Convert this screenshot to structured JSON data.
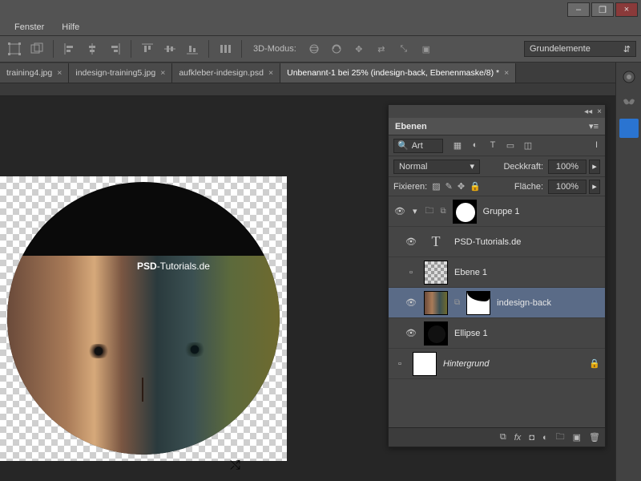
{
  "window": {
    "minimize": "–",
    "maximize": "❐",
    "close": "×"
  },
  "menu": {
    "fenster": "Fenster",
    "hilfe": "Hilfe"
  },
  "toolbar": {
    "mode_label": "3D-Modus:",
    "workspace": "Grundelemente"
  },
  "tabs": [
    {
      "label": "training4.jpg"
    },
    {
      "label": "indesign-training5.jpg"
    },
    {
      "label": "aufkleber-indesign.psd"
    },
    {
      "label": "Unbenannt-1 bei 25% (indesign-back, Ebenenmaske/8) *"
    }
  ],
  "tabs_more": "»",
  "canvas": {
    "brand_bold": "PSD",
    "brand_rest": "-Tutorials.de"
  },
  "panel": {
    "title": "Ebenen",
    "kind": "Art",
    "blend": "Normal",
    "opacity_label": "Deckkraft:",
    "opacity_value": "100%",
    "lock_label": "Fixieren:",
    "fill_label": "Fläche:",
    "fill_value": "100%",
    "layers": {
      "group": "Gruppe 1",
      "text": "PSD-Tutorials.de",
      "ebene1": "Ebene 1",
      "indesign": "indesign-back",
      "ellipse": "Ellipse 1",
      "bg": "Hintergrund"
    }
  }
}
